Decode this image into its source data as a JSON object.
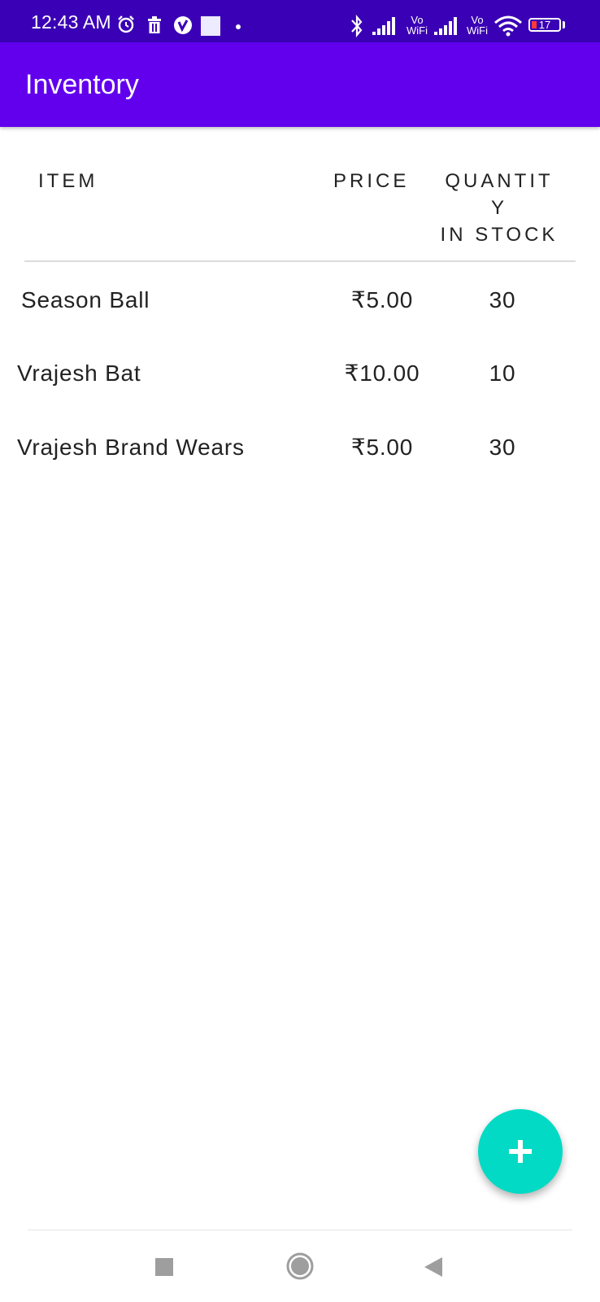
{
  "status_bar": {
    "time": "12:43 AM",
    "vowifi_1": "Vo\nWiFi",
    "vowifi_2": "Vo\nWiFi",
    "battery": "17",
    "icons": [
      "alarm-icon",
      "trash-icon",
      "vpn-icon",
      "square-notification-icon",
      "bluetooth-icon",
      "signal-icon",
      "wifi-icon",
      "battery-icon"
    ]
  },
  "app_bar": {
    "title": "Inventory"
  },
  "table": {
    "headers": {
      "item": "ITEM",
      "price": "PRICE",
      "quantity_line1": "QUANTIT",
      "quantity_line2": "Y",
      "quantity_line3": "IN STOCK"
    },
    "rows": [
      {
        "item": "Season Ball",
        "price": "₹5.00",
        "quantity": "30"
      },
      {
        "item": "Vrajesh Bat",
        "price": "₹10.00",
        "quantity": "10"
      },
      {
        "item": "Vrajesh Brand Wears",
        "price": "₹5.00",
        "quantity": "30"
      }
    ]
  },
  "fab": {
    "icon": "plus-icon"
  },
  "nav_bar": {
    "icons": [
      "recents-square-icon",
      "home-circle-icon",
      "back-triangle-icon"
    ]
  },
  "colors": {
    "status_bar": "#3a00b5",
    "app_bar": "#6200ee",
    "fab": "#03dac5",
    "text": "#222222"
  }
}
